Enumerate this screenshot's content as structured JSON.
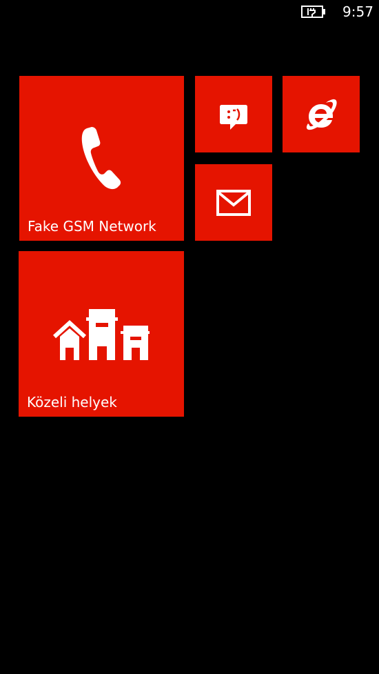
{
  "status_bar": {
    "time": "9:57",
    "battery_icon": "battery-charging-icon"
  },
  "tiles": {
    "phone": {
      "label": "Fake GSM Network",
      "icon": "phone-icon"
    },
    "messaging": {
      "icon": "messaging-icon",
      "emoticon": ":-)"
    },
    "internet_explorer": {
      "icon": "internet-explorer-icon"
    },
    "mail": {
      "icon": "mail-icon"
    },
    "local_places": {
      "label": "Közeli helyek",
      "icon": "places-icon"
    }
  },
  "colors": {
    "accent": "#e51400",
    "background": "#000000",
    "foreground": "#ffffff"
  }
}
